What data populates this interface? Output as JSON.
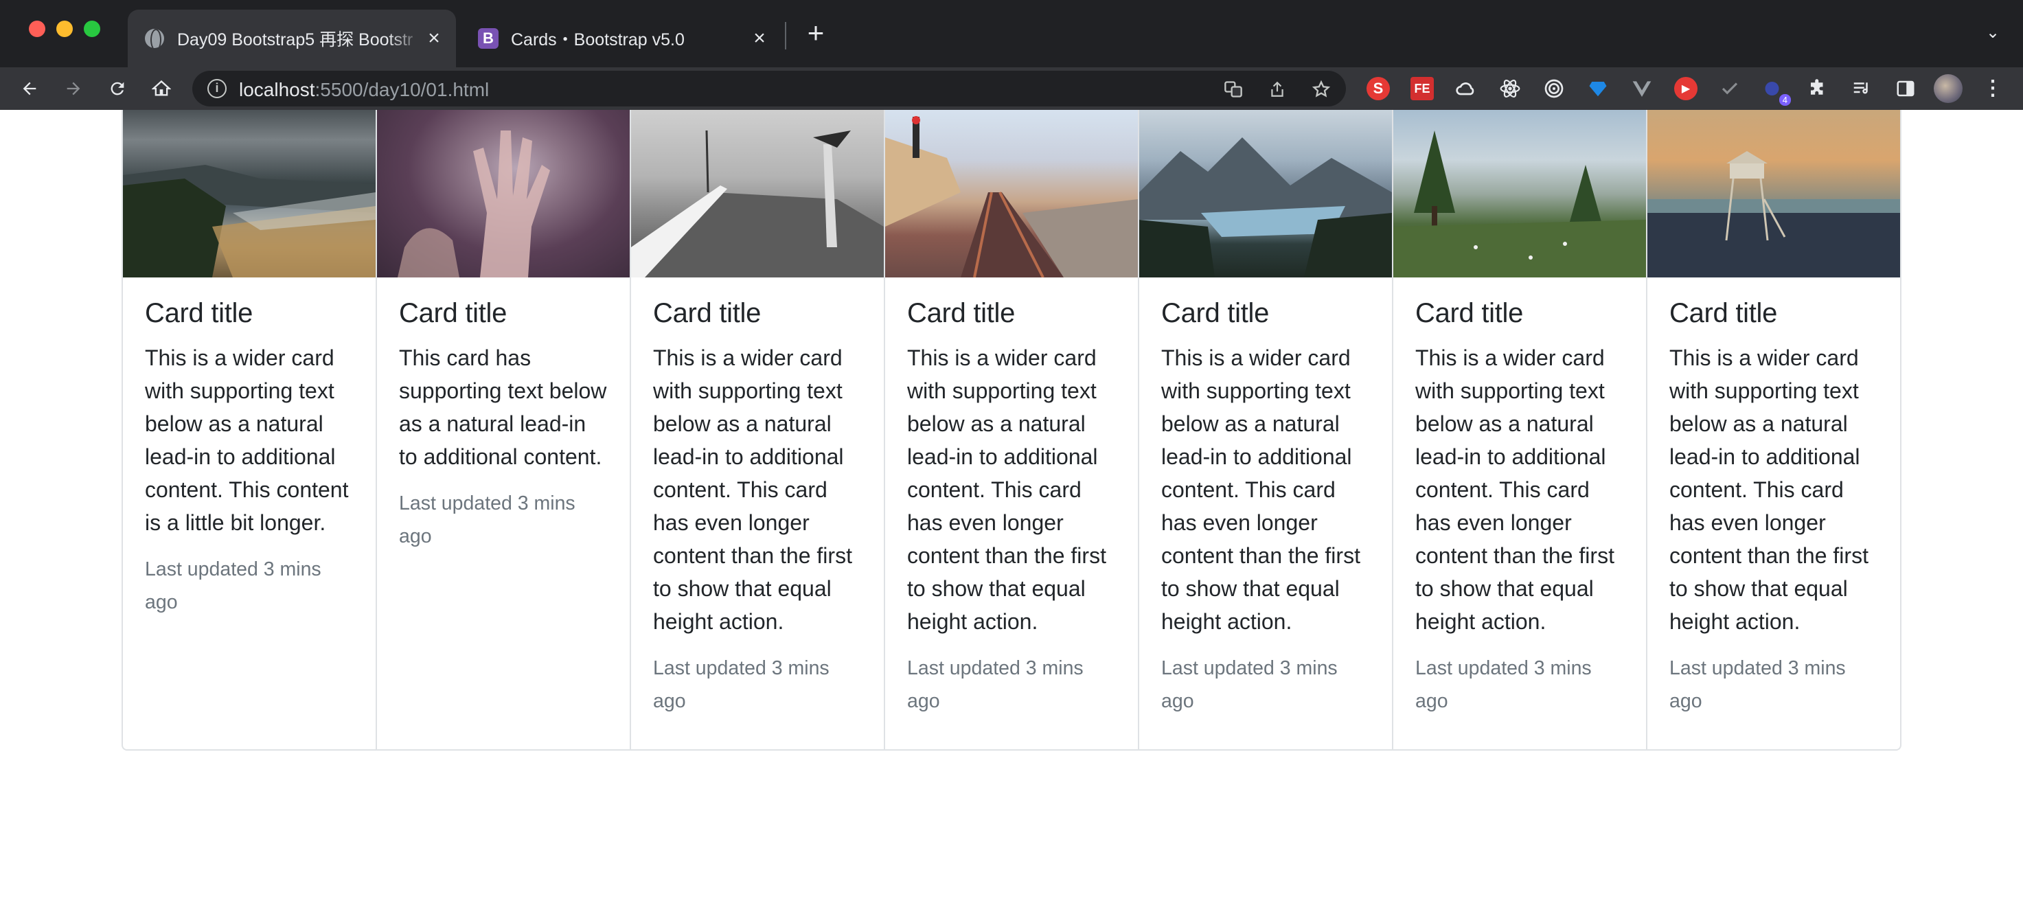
{
  "browser": {
    "tabs": [
      {
        "title": "Day09 Bootstrap5 再探 Bootstr",
        "active": true
      },
      {
        "title": "Cards・Bootstrap v5.0",
        "favicon_letter": "B",
        "active": false
      }
    ],
    "address": {
      "host": "localhost",
      "path": ":5500/day10/01.html"
    },
    "extensions": [
      "S",
      "FE",
      "4"
    ]
  },
  "cards": [
    {
      "image": "stormy-beach-photo",
      "title": "Card title",
      "text": "This is a wider card with supporting text below as a natural lead-in to additional content. This content is a little bit longer.",
      "muted": "Last updated 3 mins ago"
    },
    {
      "image": "hand-on-wet-glass-photo",
      "title": "Card title",
      "text": "This card has supporting text below as a natural lead-in to additional content.",
      "muted": "Last updated 3 mins ago"
    },
    {
      "image": "pier-lighthouse-photo",
      "title": "Card title",
      "text": "This is a wider card with supporting text below as a natural lead-in to additional content. This card has even longer content than the first to show that equal height action.",
      "muted": "Last updated 3 mins ago"
    },
    {
      "image": "coastal-railway-photo",
      "title": "Card title",
      "text": "This is a wider card with supporting text below as a natural lead-in to additional content. This card has even longer content than the first to show that equal height action.",
      "muted": "Last updated 3 mins ago"
    },
    {
      "image": "mountain-lake-photo",
      "title": "Card title",
      "text": "This is a wider card with supporting text below as a natural lead-in to additional content. This card has even longer content than the first to show that equal height action.",
      "muted": "Last updated 3 mins ago"
    },
    {
      "image": "meadow-trees-photo",
      "title": "Card title",
      "text": "This is a wider card with supporting text below as a natural lead-in to additional content. This card has even longer content than the first to show that equal height action.",
      "muted": "Last updated 3 mins ago"
    },
    {
      "image": "lifeguard-tower-sunset-photo",
      "title": "Card title",
      "text": "This is a wider card with supporting text below as a natural lead-in to additional content. This card has even longer content than the first to show that equal height action.",
      "muted": "Last updated 3 mins ago"
    }
  ]
}
